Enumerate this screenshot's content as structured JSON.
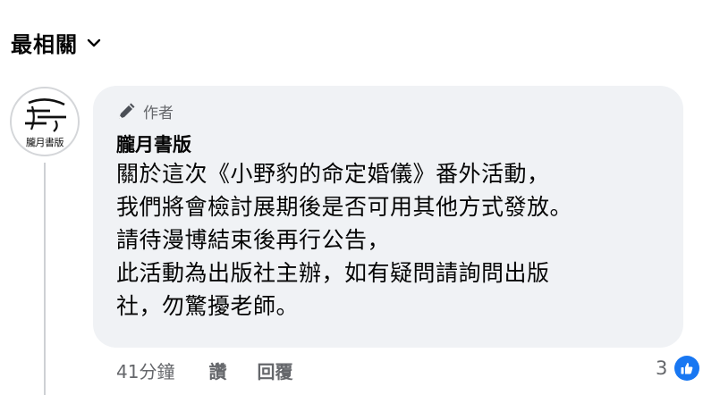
{
  "sort": {
    "label": "最相關",
    "icon": "chevron-down-icon"
  },
  "comment": {
    "avatar_text": "朧月書版",
    "badge_label": "作者",
    "badge_icon": "pen-icon",
    "author": "朧月書版",
    "lines": [
      "關於這次《小野豹的命定婚儀》番外活動，",
      "我們將會檢討展期後是否可用其他方式發放。",
      "請待漫博結束後再行公告，",
      "此活動為出版社主辦，如有疑問請詢問出版",
      "社，勿驚擾老師。"
    ],
    "time": "41分鐘",
    "like_label": "讚",
    "reply_label": "回覆",
    "reaction_count": "3",
    "reaction_icon": "like-reaction-icon"
  },
  "colors": {
    "bubble_bg": "#f0f2f5",
    "secondary_text": "#65676b",
    "like_blue": "#1877f2"
  }
}
